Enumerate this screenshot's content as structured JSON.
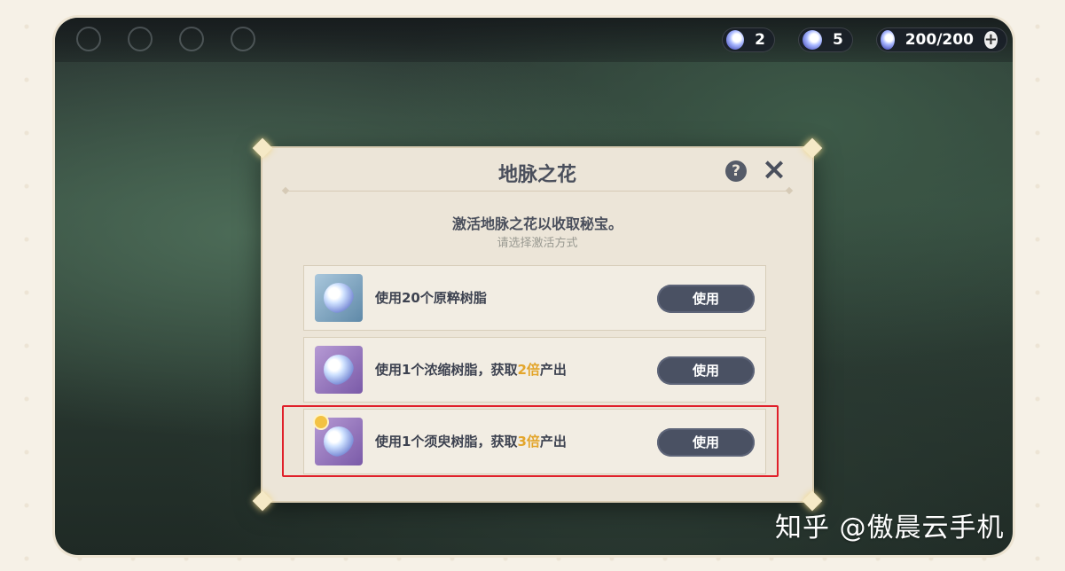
{
  "hud": {
    "currency_1_value": "2",
    "currency_2_value": "5",
    "resin_value": "200/200",
    "add_icon": "plus-icon"
  },
  "dialog": {
    "title": "地脉之花",
    "subtitle": "激活地脉之花以收取秘宝。",
    "hint": "请选择激活方式",
    "help_icon": "question-icon",
    "close_icon": "close-icon",
    "options": [
      {
        "text_before": "使用20个原粹树脂",
        "highlight": "",
        "text_after": "",
        "button": "使用",
        "icon": "original-resin-icon"
      },
      {
        "text_before": "使用1个浓缩树脂，获取",
        "highlight": "2倍",
        "text_after": "产出",
        "button": "使用",
        "icon": "condensed-resin-icon"
      },
      {
        "text_before": "使用1个须臾树脂，获取",
        "highlight": "3倍",
        "text_after": "产出",
        "button": "使用",
        "icon": "transient-resin-icon"
      }
    ]
  },
  "watermark": "知乎 @傲晨云手机",
  "colors": {
    "accent_highlight": "#e3a52b",
    "button_bg": "#4a5163",
    "annotation_box": "#e0202a"
  }
}
